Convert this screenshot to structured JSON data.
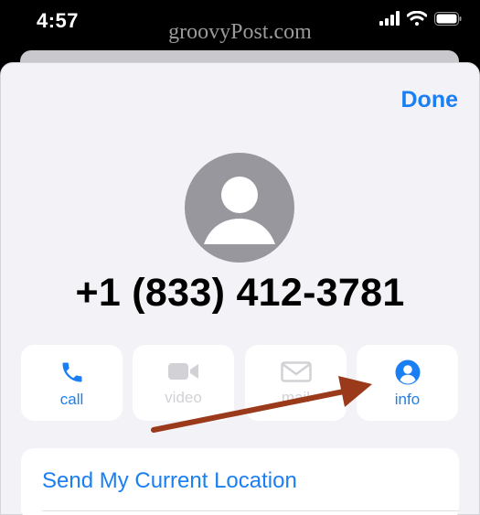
{
  "status_bar": {
    "time": "4:57",
    "icons": [
      "signal-icon",
      "wifi-icon",
      "battery-icon"
    ]
  },
  "watermark": "groovyPost.com",
  "header": {
    "done_label": "Done"
  },
  "contact": {
    "avatar_icon": "person-placeholder-icon",
    "phone_number": "+1 (833) 412-3781"
  },
  "actions": [
    {
      "label": "call",
      "icon": "phone-icon",
      "enabled": true
    },
    {
      "label": "video",
      "icon": "video-camera-icon",
      "enabled": false
    },
    {
      "label": "mail",
      "icon": "envelope-icon",
      "enabled": false
    },
    {
      "label": "info",
      "icon": "person-circle-icon",
      "enabled": true
    }
  ],
  "location": {
    "label": "Send My Current Location"
  },
  "colors": {
    "accent": "#1a7ff2",
    "sheet_background": "#f2f2f7",
    "disabled": "#d2d2d6",
    "annotation_arrow": "#9b3a1b"
  }
}
